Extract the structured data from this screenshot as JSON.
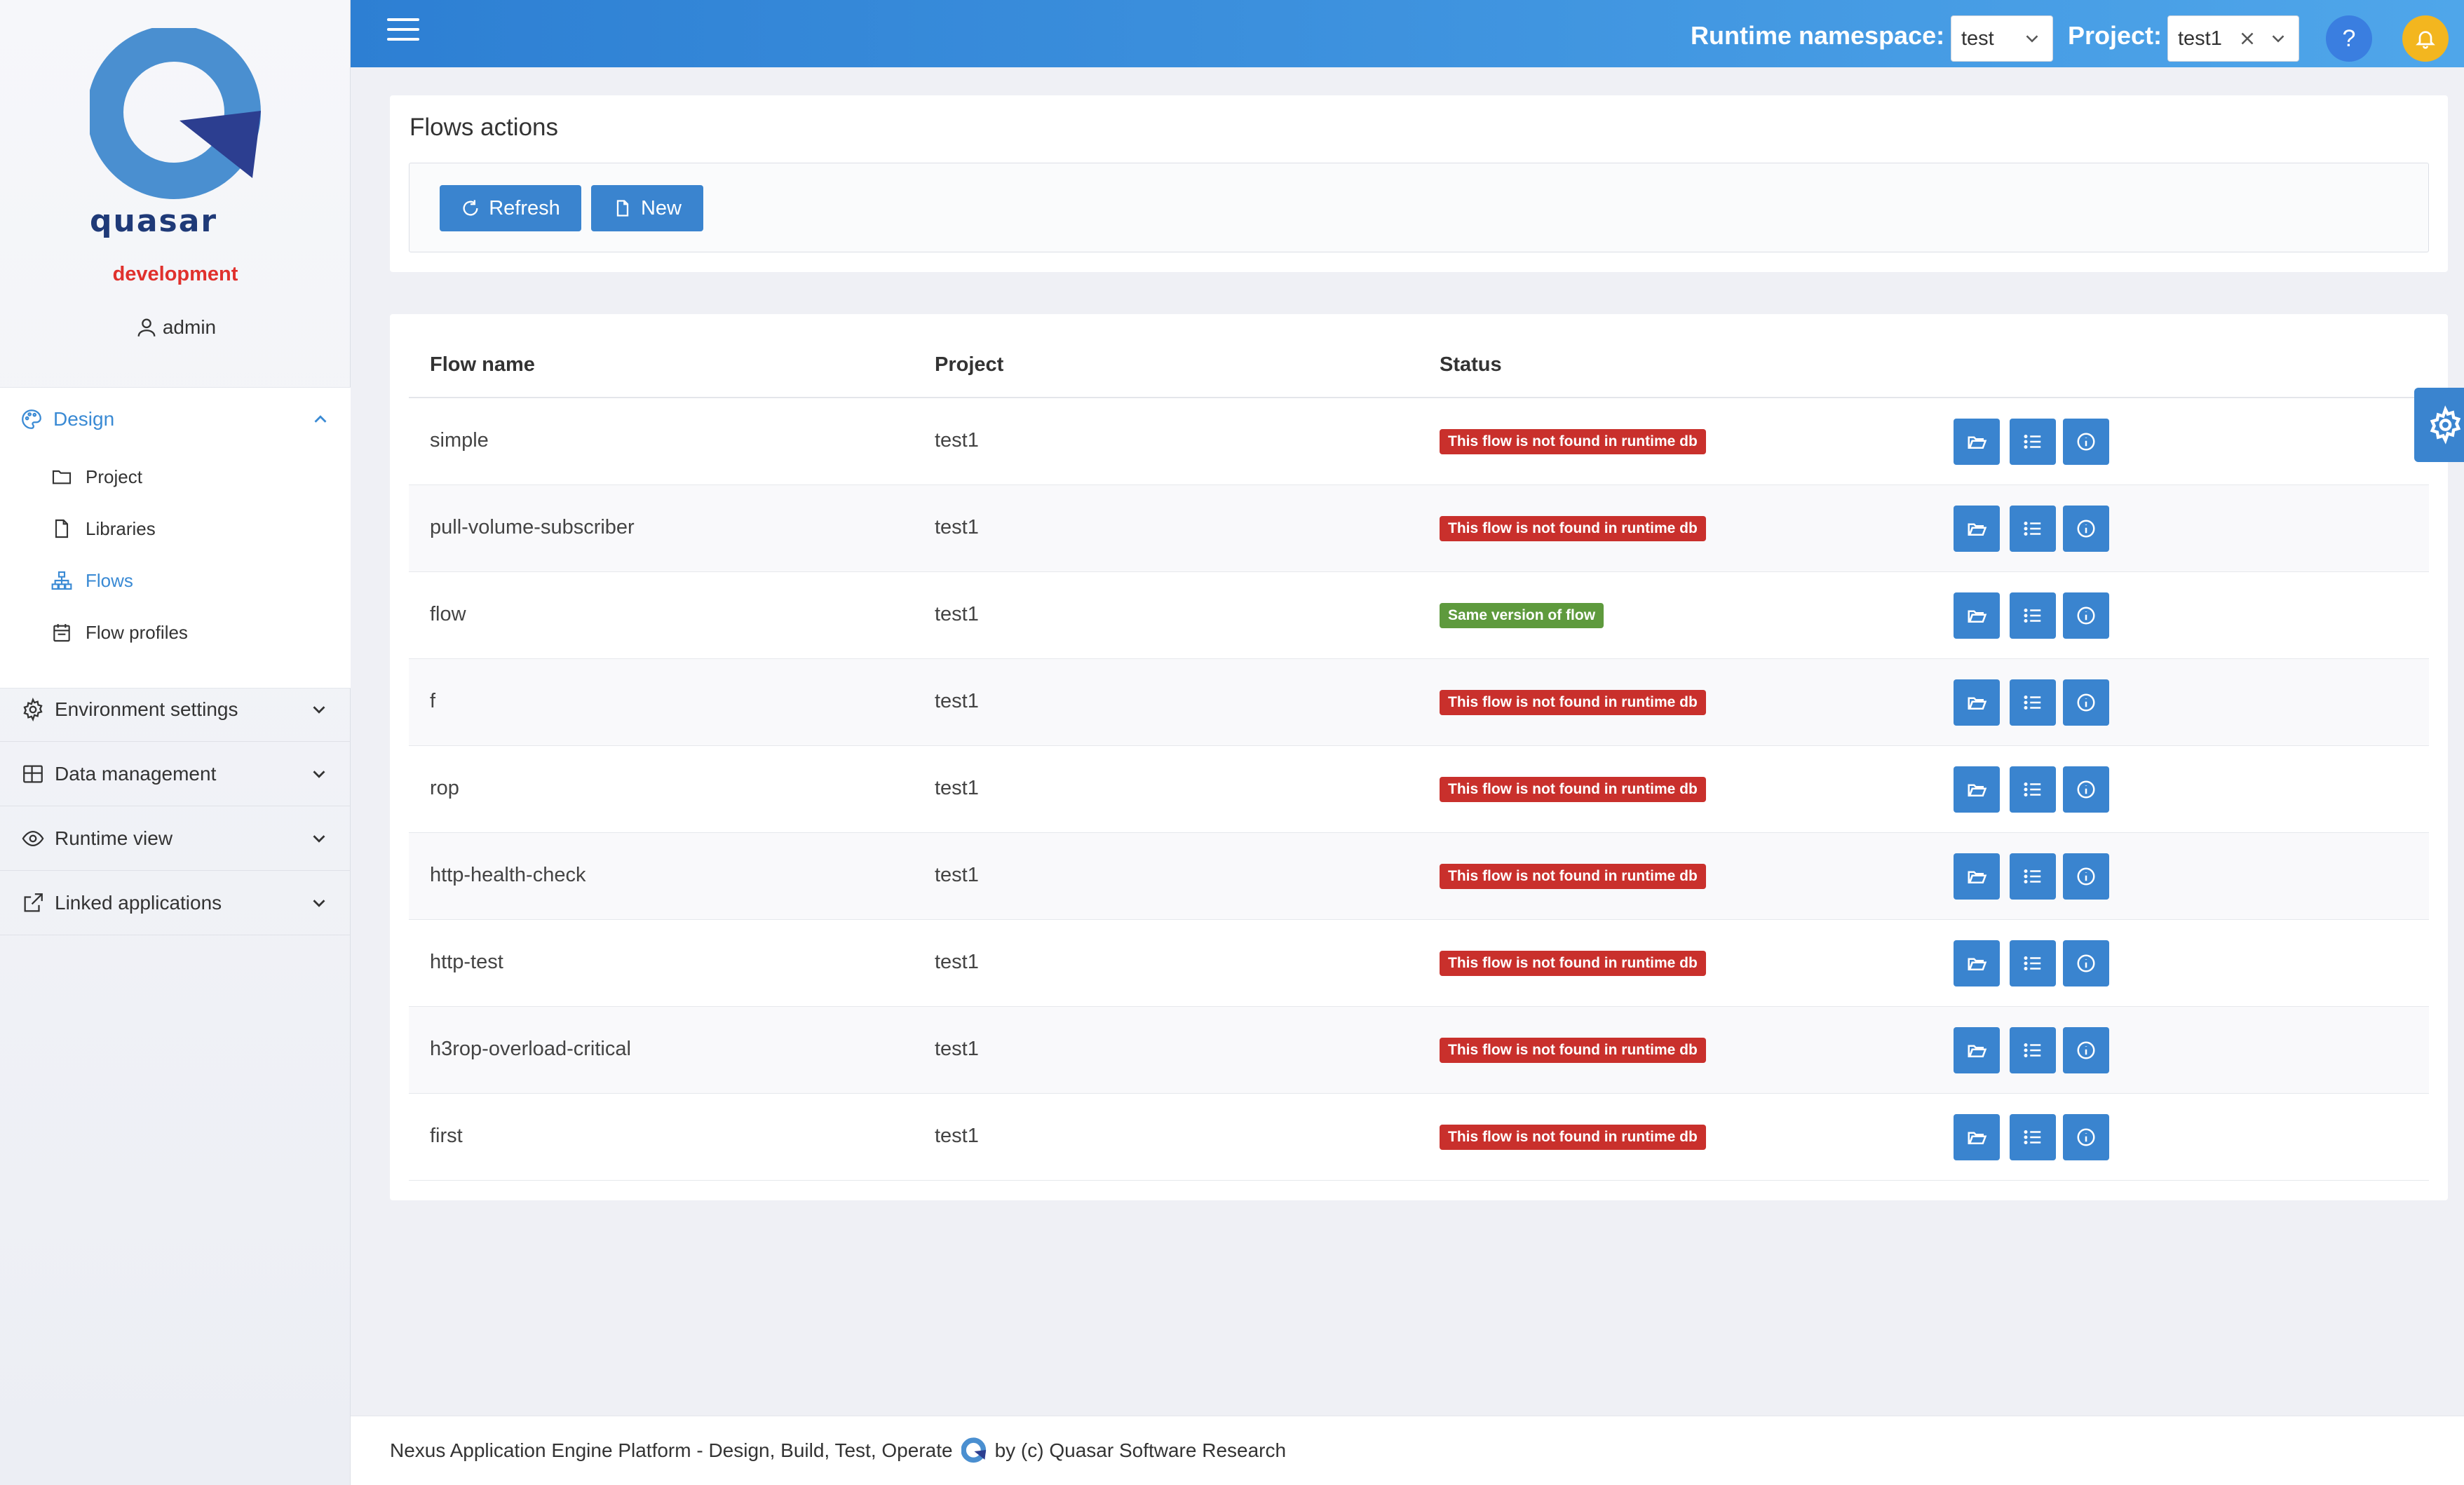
{
  "sidebar": {
    "logo_text": "quasar",
    "environment": "development",
    "user": "admin",
    "design": {
      "label": "Design",
      "items": [
        {
          "label": "Project",
          "icon": "folder-icon",
          "active": false
        },
        {
          "label": "Libraries",
          "icon": "file-icon",
          "active": false
        },
        {
          "label": "Flows",
          "icon": "flow-tree-icon",
          "active": true
        },
        {
          "label": "Flow profiles",
          "icon": "calendar-icon",
          "active": false
        }
      ]
    },
    "sections": [
      {
        "label": "Environment settings",
        "icon": "gear-icon"
      },
      {
        "label": "Data management",
        "icon": "grid-icon"
      },
      {
        "label": "Runtime view",
        "icon": "eye-icon"
      },
      {
        "label": "Linked applications",
        "icon": "external-link-icon"
      }
    ]
  },
  "topbar": {
    "namespace_label": "Runtime namespace:",
    "namespace_value": "test",
    "project_label": "Project:",
    "project_value": "test1",
    "help": "?",
    "colors": {
      "help": "#3a7ee0",
      "bell": "#f3b61f"
    }
  },
  "actions": {
    "title": "Flows actions",
    "refresh": "Refresh",
    "new": "New"
  },
  "table": {
    "headers": [
      "Flow name",
      "Project",
      "Status"
    ],
    "rows": [
      {
        "name": "simple",
        "project": "test1",
        "status": "This flow is not found in runtime db",
        "status_type": "error"
      },
      {
        "name": "pull-volume-subscriber",
        "project": "test1",
        "status": "This flow is not found in runtime db",
        "status_type": "error"
      },
      {
        "name": "flow",
        "project": "test1",
        "status": "Same version of flow",
        "status_type": "ok"
      },
      {
        "name": "f",
        "project": "test1",
        "status": "This flow is not found in runtime db",
        "status_type": "error"
      },
      {
        "name": "rop",
        "project": "test1",
        "status": "This flow is not found in runtime db",
        "status_type": "error"
      },
      {
        "name": "http-health-check",
        "project": "test1",
        "status": "This flow is not found in runtime db",
        "status_type": "error"
      },
      {
        "name": "http-test",
        "project": "test1",
        "status": "This flow is not found in runtime db",
        "status_type": "error"
      },
      {
        "name": "h3rop-overload-critical",
        "project": "test1",
        "status": "This flow is not found in runtime db",
        "status_type": "error"
      },
      {
        "name": "first",
        "project": "test1",
        "status": "This flow is not found in runtime db",
        "status_type": "error"
      }
    ],
    "row_actions": [
      "open-folder-icon",
      "list-icon",
      "info-icon"
    ]
  },
  "footer": {
    "left": "Nexus Application Engine Platform - Design, Build, Test, Operate",
    "right": "by (c) Quasar Software Research"
  },
  "colors": {
    "primary": "#3a84cf",
    "error": "#c9302c",
    "success": "#5e9a3d",
    "env": "#e0312d"
  }
}
